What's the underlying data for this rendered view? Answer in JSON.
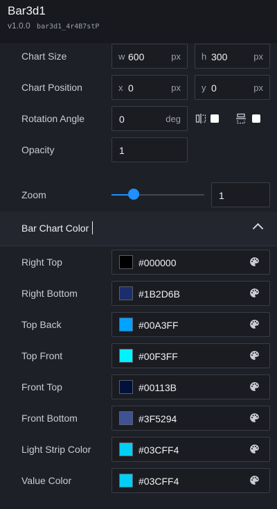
{
  "header": {
    "title": "Bar3d1",
    "version": "v1.0.0",
    "id": "bar3d1_4r4B7stP"
  },
  "chart_size": {
    "label": "Chart Size",
    "w_prefix": "w",
    "w_value": "600",
    "h_prefix": "h",
    "h_value": "300",
    "unit": "px"
  },
  "chart_position": {
    "label": "Chart Position",
    "x_prefix": "x",
    "x_value": "0",
    "y_prefix": "y",
    "y_value": "0",
    "unit": "px"
  },
  "rotation": {
    "label": "Rotation Angle",
    "value": "0",
    "unit": "deg",
    "flip_horizontal_checked": false,
    "flip_vertical_checked": false
  },
  "opacity": {
    "label": "Opacity",
    "value": "1"
  },
  "zoom": {
    "label": "Zoom",
    "value": "1",
    "slider_fraction": 0.24
  },
  "section": {
    "title": "Bar Chart Color",
    "expanded": true
  },
  "colors": [
    {
      "label": "Right Top",
      "hex": "#000000"
    },
    {
      "label": "Right Bottom",
      "hex": "#1B2D6B"
    },
    {
      "label": "Top Back",
      "hex": "#00A3FF"
    },
    {
      "label": "Top Front",
      "hex": "#00F3FF"
    },
    {
      "label": "Front Top",
      "hex": "#00113B"
    },
    {
      "label": "Front Bottom",
      "hex": "#3F5294"
    },
    {
      "label": "Light Strip Color",
      "hex": "#03CFF4"
    },
    {
      "label": "Value Color",
      "hex": "#03CFF4"
    }
  ],
  "icons": {
    "palette": "palette-icon",
    "flip_h": "flip-horizontal-icon",
    "flip_v": "flip-vertical-icon",
    "collapse": "chevron-up-icon"
  },
  "theme": {
    "accent": "#1E90FF",
    "background": "#1E2027",
    "input_border": "#3A3D46"
  }
}
